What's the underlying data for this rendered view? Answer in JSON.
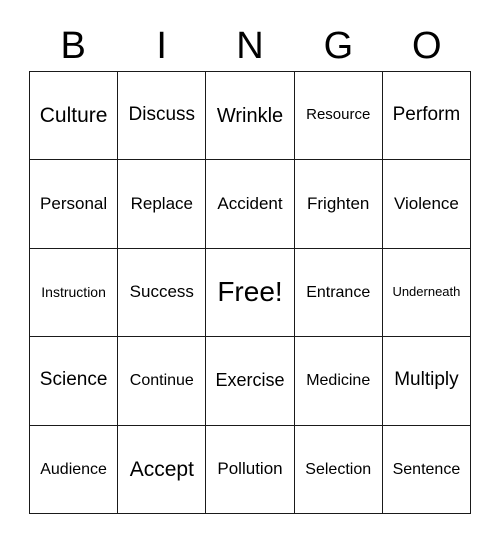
{
  "card": {
    "header_letters": [
      "B",
      "I",
      "N",
      "G",
      "O"
    ],
    "free_space_label": "Free!",
    "columns": 5,
    "rows": 5,
    "colors": {
      "background": "#ffffff",
      "border": "#1a1a1a",
      "text": "#000000"
    },
    "grid": [
      [
        {
          "label": "Culture",
          "size": 21
        },
        {
          "label": "Discuss",
          "size": 19
        },
        {
          "label": "Wrinkle",
          "size": 20
        },
        {
          "label": "Resource",
          "size": 15
        },
        {
          "label": "Perform",
          "size": 19
        }
      ],
      [
        {
          "label": "Personal",
          "size": 17
        },
        {
          "label": "Replace",
          "size": 17
        },
        {
          "label": "Accident",
          "size": 17
        },
        {
          "label": "Frighten",
          "size": 17
        },
        {
          "label": "Violence",
          "size": 17
        }
      ],
      [
        {
          "label": "Instruction",
          "size": 14
        },
        {
          "label": "Success",
          "size": 17
        },
        {
          "label": "Free!",
          "size": 28
        },
        {
          "label": "Entrance",
          "size": 16
        },
        {
          "label": "Underneath",
          "size": 13
        }
      ],
      [
        {
          "label": "Science",
          "size": 19
        },
        {
          "label": "Continue",
          "size": 16
        },
        {
          "label": "Exercise",
          "size": 18
        },
        {
          "label": "Medicine",
          "size": 16
        },
        {
          "label": "Multiply",
          "size": 19
        }
      ],
      [
        {
          "label": "Audience",
          "size": 16
        },
        {
          "label": "Accept",
          "size": 21
        },
        {
          "label": "Pollution",
          "size": 17
        },
        {
          "label": "Selection",
          "size": 16
        },
        {
          "label": "Sentence",
          "size": 16
        }
      ]
    ]
  }
}
